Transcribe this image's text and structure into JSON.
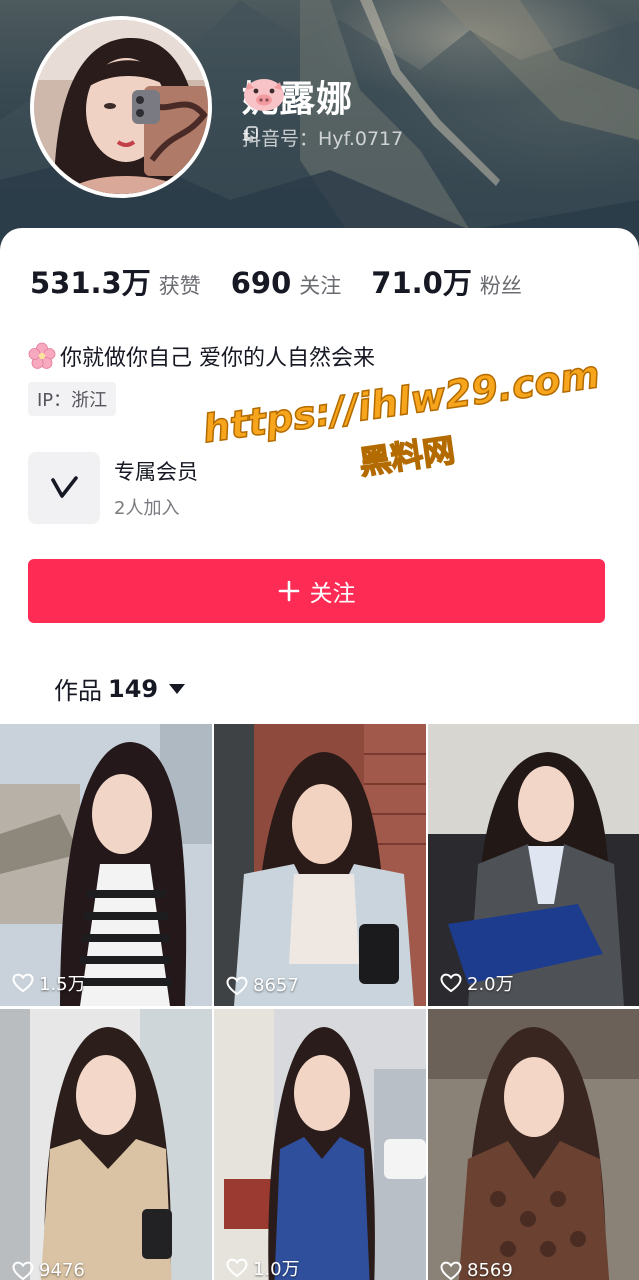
{
  "profile": {
    "nickname": "妮露娜",
    "nickname_emoji": "pig-face-icon",
    "douyin_id": "抖音号：Hyf.0717",
    "avatar": "avatar-photo"
  },
  "stats": [
    {
      "value": "531.3万",
      "label": "获赞"
    },
    {
      "value": "690",
      "label": "关注"
    },
    {
      "value": "71.0万",
      "label": "粉丝"
    }
  ],
  "bio": {
    "emoji": "cherry-blossom-icon",
    "text": "你就做你自己  爱你的人自然会来"
  },
  "ip_tag": "IP：浙江",
  "membership": {
    "title": "专属会员",
    "subtitle": "2人加入"
  },
  "follow_button": {
    "icon": "plus-icon",
    "label": "关注",
    "color": "#fe2c55"
  },
  "works_tab": {
    "label": "作品",
    "count": "149"
  },
  "videos": [
    {
      "likes": "1.5万"
    },
    {
      "likes": "8657"
    },
    {
      "likes": "2.0万"
    },
    {
      "likes": "9476"
    },
    {
      "likes": "1.0万"
    },
    {
      "likes": "8569"
    }
  ],
  "watermark": {
    "line1": "https://ihlw29.com",
    "line2": "黑料网"
  }
}
